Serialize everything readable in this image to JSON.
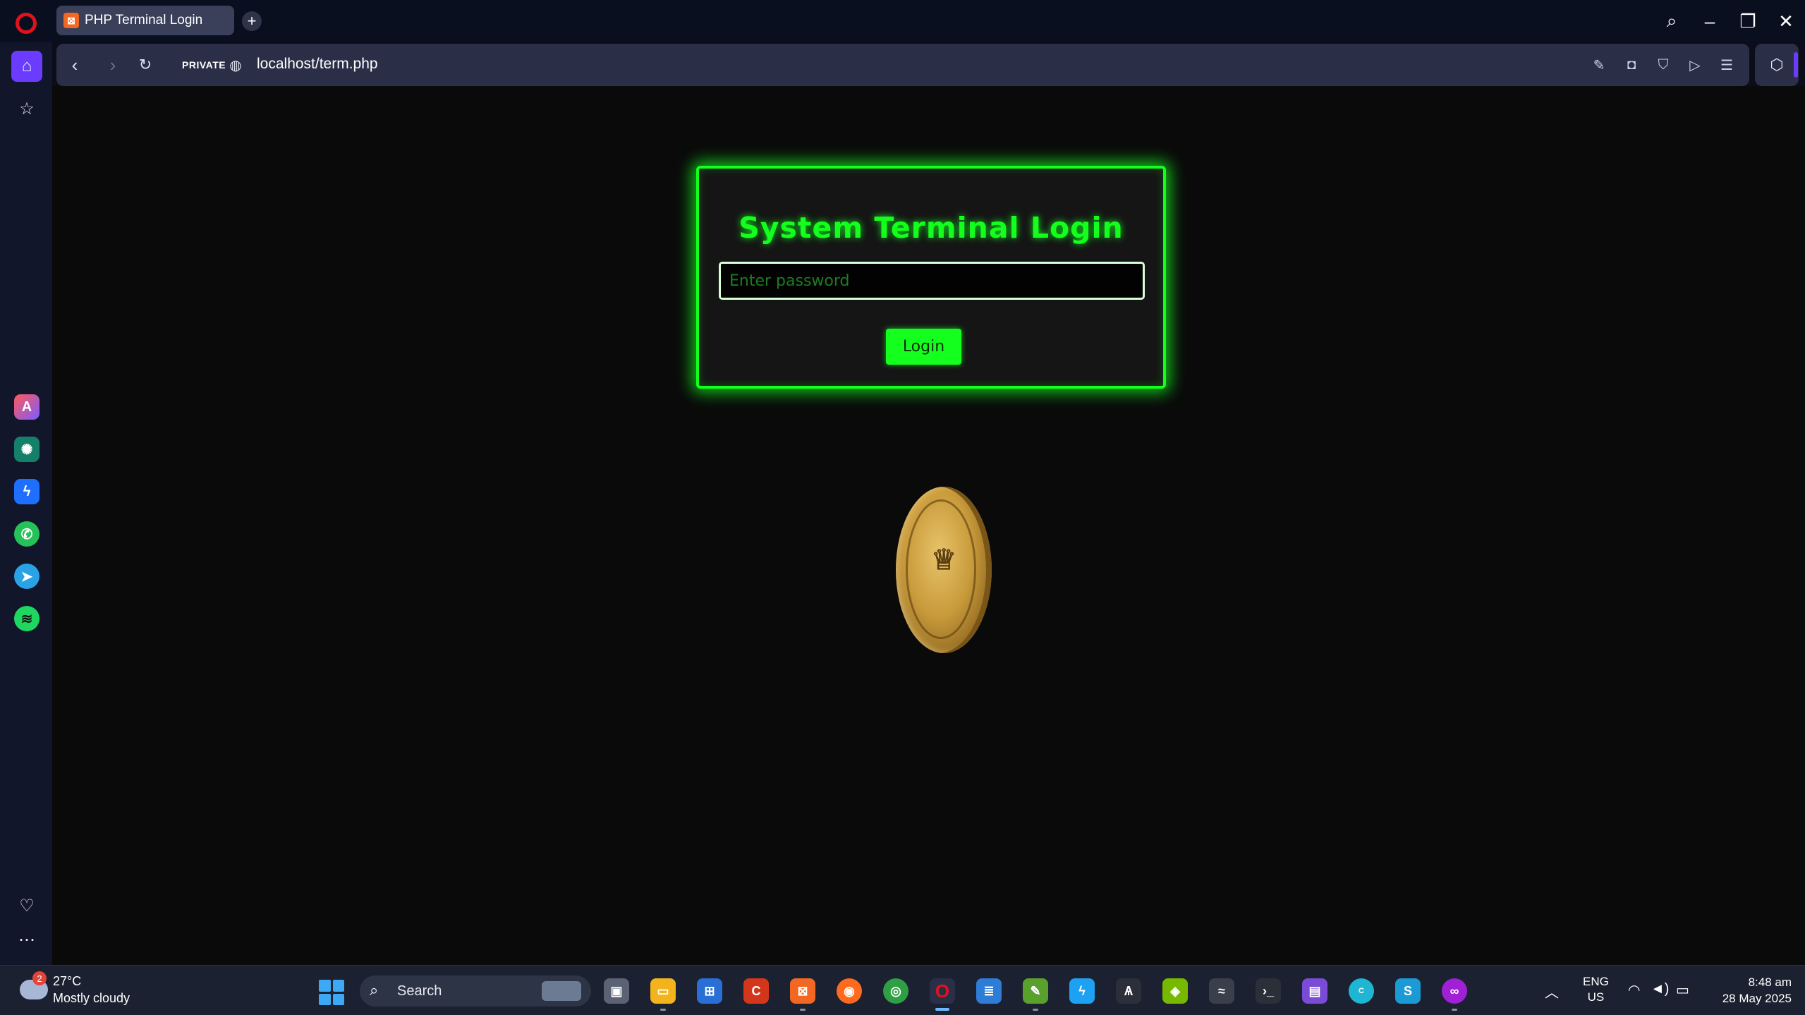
{
  "browser": {
    "tab_title": "PHP Terminal Login",
    "private_label": "PRIVATE",
    "url": "localhost/term.php"
  },
  "page": {
    "title": "System Terminal Login",
    "password_placeholder": "Enter password",
    "login_label": "Login"
  },
  "taskbar": {
    "weather_temp": "27°C",
    "weather_desc": "Mostly cloudy",
    "weather_badge": "2",
    "search_label": "Search",
    "lang_line1": "ENG",
    "lang_line2": "US",
    "time": "8:48 am",
    "date": "28 May 2025"
  },
  "colors": {
    "accent_green": "#14ff1e",
    "browser_accent": "#6b3cff",
    "opera_red": "#e1121c"
  }
}
